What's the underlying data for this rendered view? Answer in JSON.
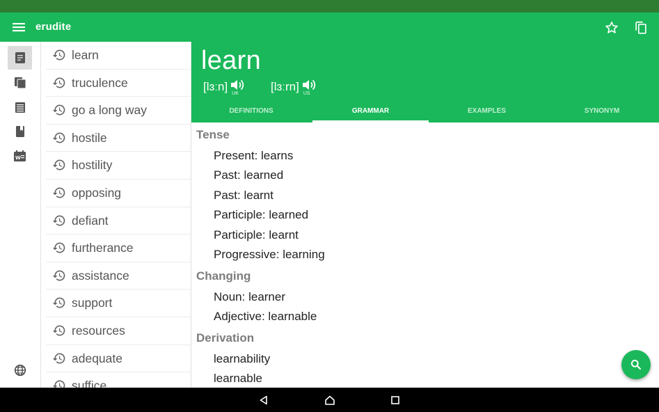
{
  "app": {
    "title": "erudite"
  },
  "colors": {
    "primary": "#1ab85a",
    "status_bar": "#2f7d32",
    "nav_bar": "#000000"
  },
  "appbar_icons": {
    "menu": "menu-icon",
    "favorite": "star-outline-icon",
    "copy": "copy-icon"
  },
  "rail": {
    "items": [
      {
        "icon": "document-icon",
        "active": true
      },
      {
        "icon": "documents-stack-icon",
        "active": false
      },
      {
        "icon": "list-article-icon",
        "active": false
      },
      {
        "icon": "book-icon",
        "active": false
      },
      {
        "icon": "calendar-word-icon",
        "active": false
      }
    ],
    "bottom_icon": "globe-icon"
  },
  "history": {
    "items": [
      "learn",
      "truculence",
      "go a long way",
      "hostile",
      "hostility",
      "opposing",
      "defiant",
      "furtherance",
      "assistance",
      "support",
      "resources",
      "adequate",
      "suffice"
    ]
  },
  "entry": {
    "word": "learn",
    "pronunciations": [
      {
        "ipa": "[lɜːn]",
        "region": "UK"
      },
      {
        "ipa": "[lɜːrn]",
        "region": "US"
      }
    ]
  },
  "tabs": [
    {
      "label": "DEFINITIONS",
      "active": false
    },
    {
      "label": "GRAMMAR",
      "active": true
    },
    {
      "label": "EXAMPLES",
      "active": false
    },
    {
      "label": "SYNONYM",
      "active": false
    }
  ],
  "grammar": {
    "tense_title": "Tense",
    "tense": [
      "Present: learns",
      "Past: learned",
      "Past: learnt",
      "Participle: learned",
      "Participle: learnt",
      "Progressive: learning"
    ],
    "changing_title": "Changing",
    "changing": [
      "Noun: learner",
      "Adjective: learnable"
    ],
    "derivation_title": "Derivation",
    "derivation": [
      "learnability",
      "learnable"
    ]
  },
  "fab": {
    "icon": "search-icon"
  },
  "nav": {
    "back": "back-icon",
    "home": "home-icon",
    "recents": "recents-icon"
  }
}
